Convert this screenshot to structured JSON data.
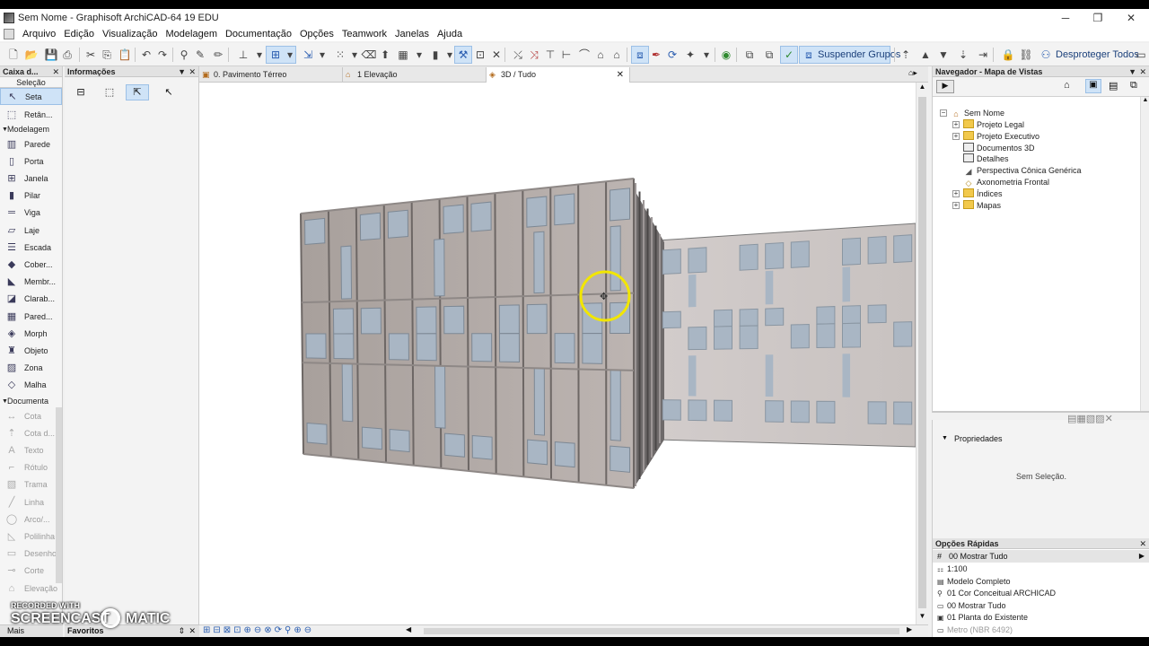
{
  "window": {
    "title": "Sem Nome - Graphisoft ArchiCAD-64 19 EDU",
    "minimize": "─",
    "maximize": "❐",
    "close": "✕"
  },
  "menu": [
    "Arquivo",
    "Edição",
    "Visualização",
    "Modelagem",
    "Documentação",
    "Opções",
    "Teamwork",
    "Janelas",
    "Ajuda"
  ],
  "toolbar": {
    "suspend_groups": "Suspender Grupos",
    "unprotect_all": "Desproteger Todos"
  },
  "toolbox": {
    "title": "Caixa d...",
    "selection_header": "Seleção",
    "arrow": "Seta",
    "marquee": "Retân...",
    "modeling_group": "Modelagem",
    "modeling_tools": [
      "Parede",
      "Porta",
      "Janela",
      "Pilar",
      "Viga",
      "Laje",
      "Escada",
      "Cober...",
      "Membr...",
      "Clarab...",
      "Pared...",
      "Morph",
      "Objeto",
      "Zona",
      "Malha"
    ],
    "doc_group": "Documenta",
    "doc_tools": [
      "Cota",
      "Cota d...",
      "Texto",
      "Rótulo",
      "Trama",
      "Linha",
      "Arco/...",
      "Polilinha",
      "Desenho",
      "Corte",
      "Elevação"
    ],
    "more": "Mais"
  },
  "infobox": {
    "title": "Informações",
    "favorites": "Favoritos"
  },
  "tabs": [
    {
      "label": "0. Pavimento Térreo",
      "active": false
    },
    {
      "label": "1 Elevação",
      "active": false
    },
    {
      "label": "3D / Tudo",
      "active": true
    }
  ],
  "navigator": {
    "title": "Navegador - Mapa de Vistas",
    "root": "Sem Nome",
    "items": [
      "Projeto Legal",
      "Projeto Executivo",
      "Documentos 3D",
      "Detalhes",
      "Perspectiva Cônica Genérica",
      "Axonometria Frontal",
      "Índices",
      "Mapas"
    ]
  },
  "properties": {
    "header": "Propriedades",
    "empty": "Sem Seleção."
  },
  "quick_options": {
    "title": "Opções Rápidas",
    "selected": "00 Mostrar Tudo",
    "rows": [
      "1:100",
      "Modelo Completo",
      "01 Cor Conceitual ARCHICAD",
      "00 Mostrar Tudo",
      "01 Planta do Existente",
      "Metro (NBR 6492)"
    ]
  },
  "watermark": {
    "line1": "RECORDED WITH",
    "line2": "SCREENCAST",
    "line3": "MATIC"
  },
  "colors": {
    "selection": "#cfe3f7",
    "facade": "#b4aca9",
    "glass": "#a9b6c4",
    "cursor_ring": "#f2e600"
  }
}
